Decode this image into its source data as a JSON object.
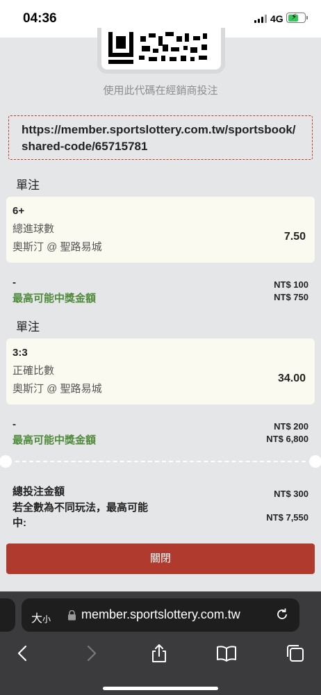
{
  "status_bar": {
    "time": "04:36",
    "network": "4G"
  },
  "qr": {
    "caption": "使用此代碼在經銷商投注"
  },
  "share_url": {
    "line1": "https://member.sportslottery.com.tw/sportsbook/",
    "line2": "shared-code/65715781"
  },
  "bets": [
    {
      "section_title": "單注",
      "pick": "6+",
      "market": "總進球數",
      "match": "奧斯汀 @ 聖路易城",
      "odds": "7.50",
      "stake_label": "-",
      "max_label": "最高可能中獎金額",
      "stake": "NT$ 100",
      "max_win": "NT$ 750"
    },
    {
      "section_title": "單注",
      "pick": "3:3",
      "market": "正確比數",
      "match": "奧斯汀 @ 聖路易城",
      "odds": "34.00",
      "stake_label": "-",
      "max_label": "最高可能中獎金額",
      "stake": "NT$ 200",
      "max_win": "NT$ 6,800"
    }
  ],
  "summary": {
    "total_label": "總投注金額",
    "total_value": "NT$ 300",
    "max_label_line1": "若全數為不同玩法，最高可能",
    "max_label_line2": "中:",
    "max_value": "NT$ 7,550"
  },
  "close_button": "關閉",
  "browser": {
    "text_size_big": "大",
    "text_size_small": "小",
    "domain": "member.sportslottery.com.tw"
  },
  "icons": [
    "signal-icon",
    "battery-icon",
    "lock-icon",
    "reload-icon",
    "back-icon",
    "forward-icon",
    "share-icon",
    "bookmarks-icon",
    "tabs-icon"
  ]
}
